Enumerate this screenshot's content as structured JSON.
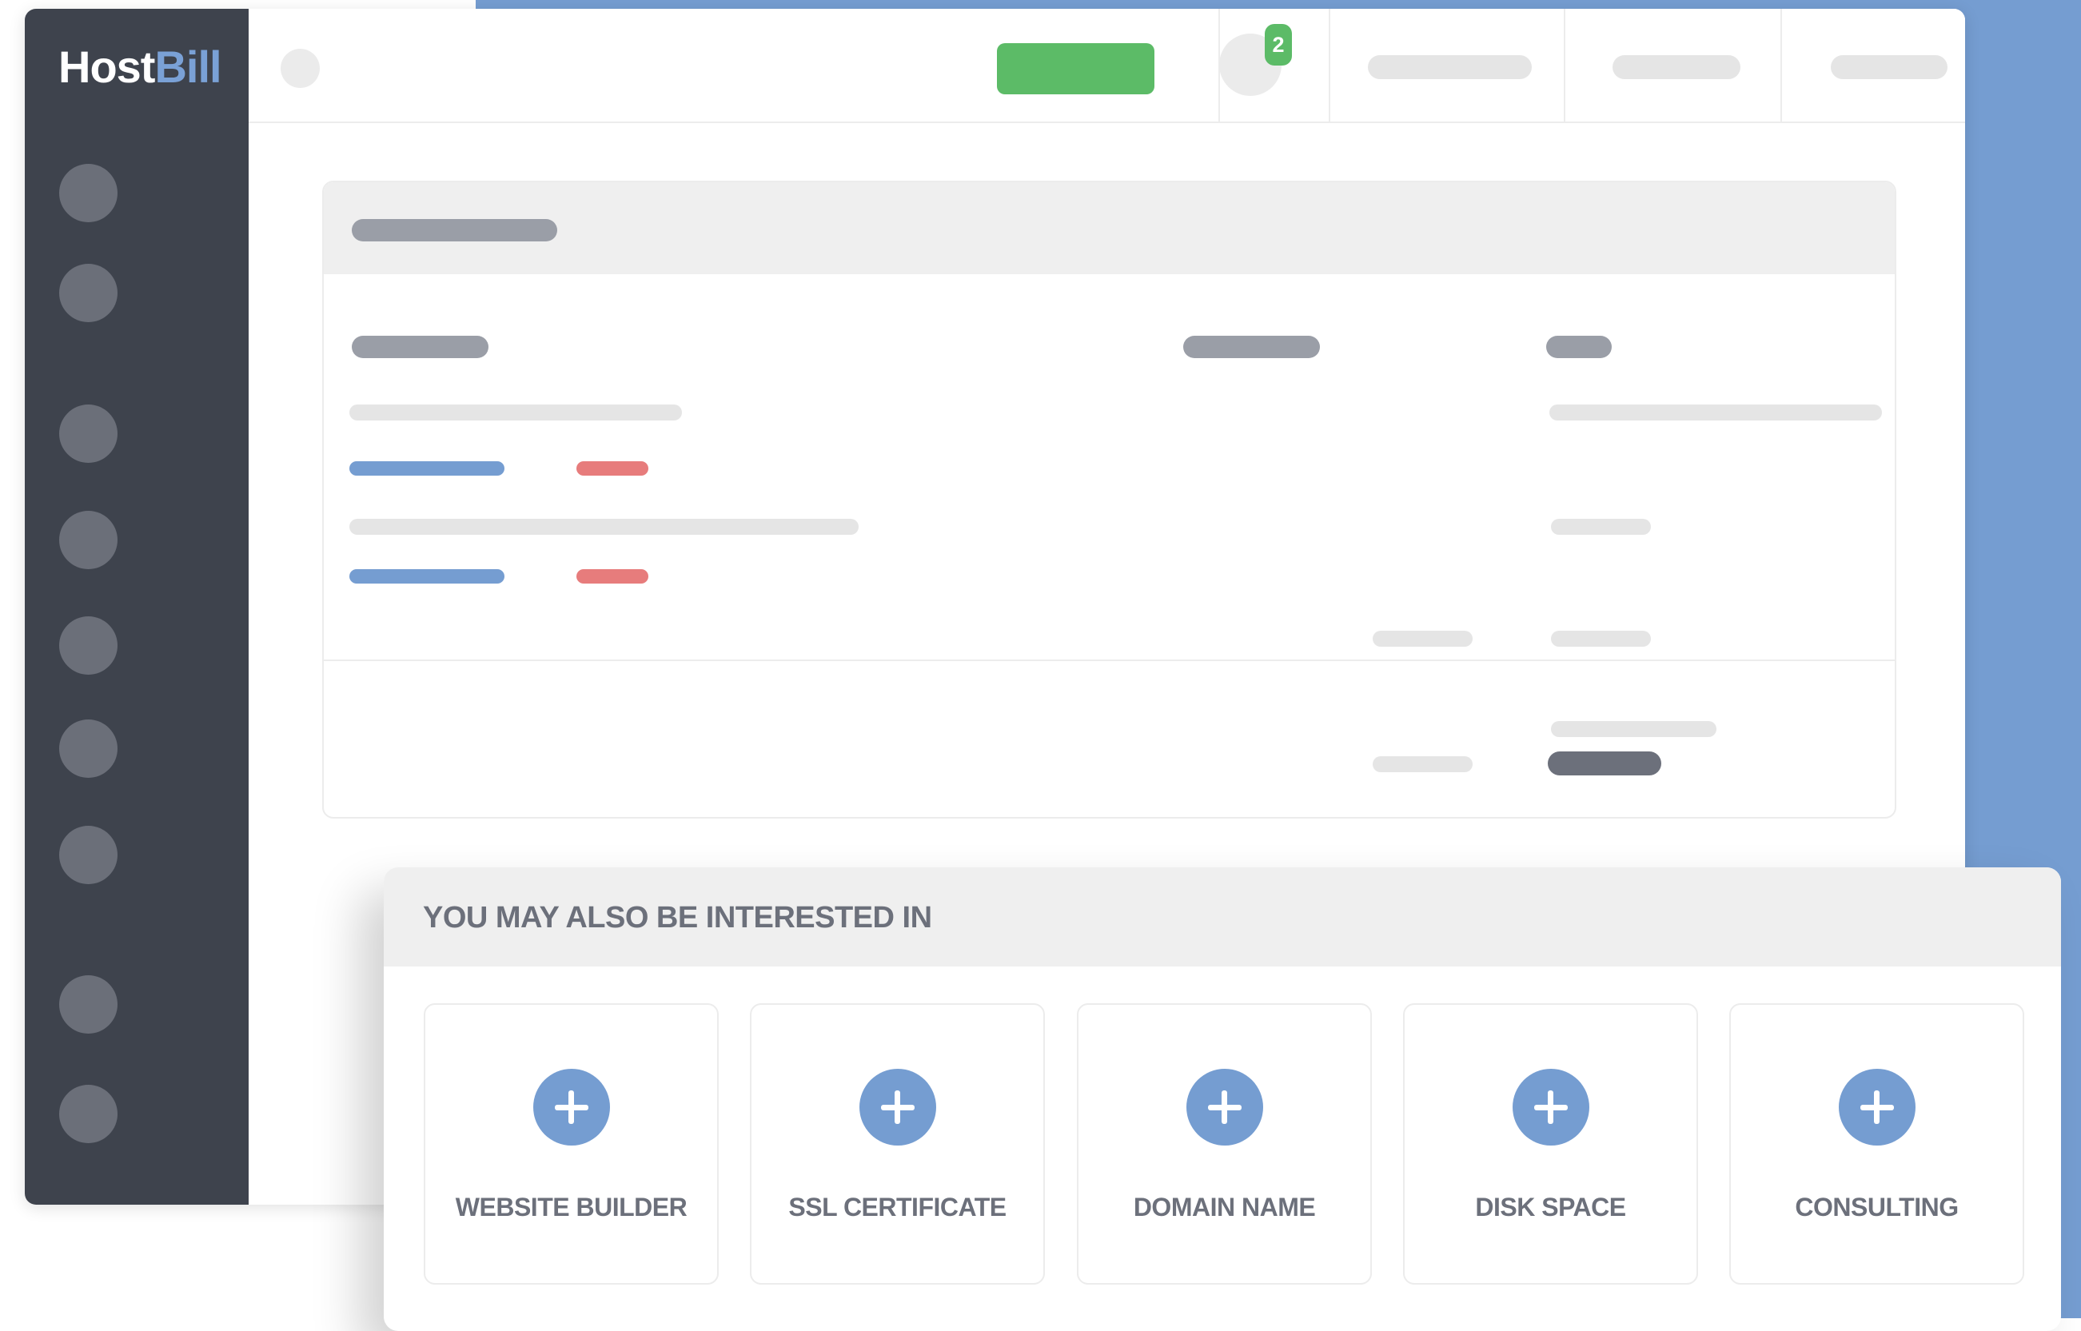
{
  "app": {
    "logo_primary": "Host",
    "logo_accent": "Bill"
  },
  "topbar": {
    "notification_count": "2"
  },
  "addons_panel": {
    "title": "YOU MAY ALSO BE INTERESTED IN",
    "items": [
      {
        "label": "WEBSITE BUILDER",
        "icon": "plus-icon"
      },
      {
        "label": "SSL CERTIFICATE",
        "icon": "plus-icon"
      },
      {
        "label": "DOMAIN NAME",
        "icon": "plus-icon"
      },
      {
        "label": "DISK SPACE",
        "icon": "plus-icon"
      },
      {
        "label": "CONSULTING",
        "icon": "plus-icon"
      }
    ]
  },
  "colors": {
    "accent_blue": "#759dd1",
    "sidebar": "#3e434d",
    "success_green": "#5cbb67",
    "danger_red": "#e77c7c",
    "text_gray": "#6c707b"
  }
}
